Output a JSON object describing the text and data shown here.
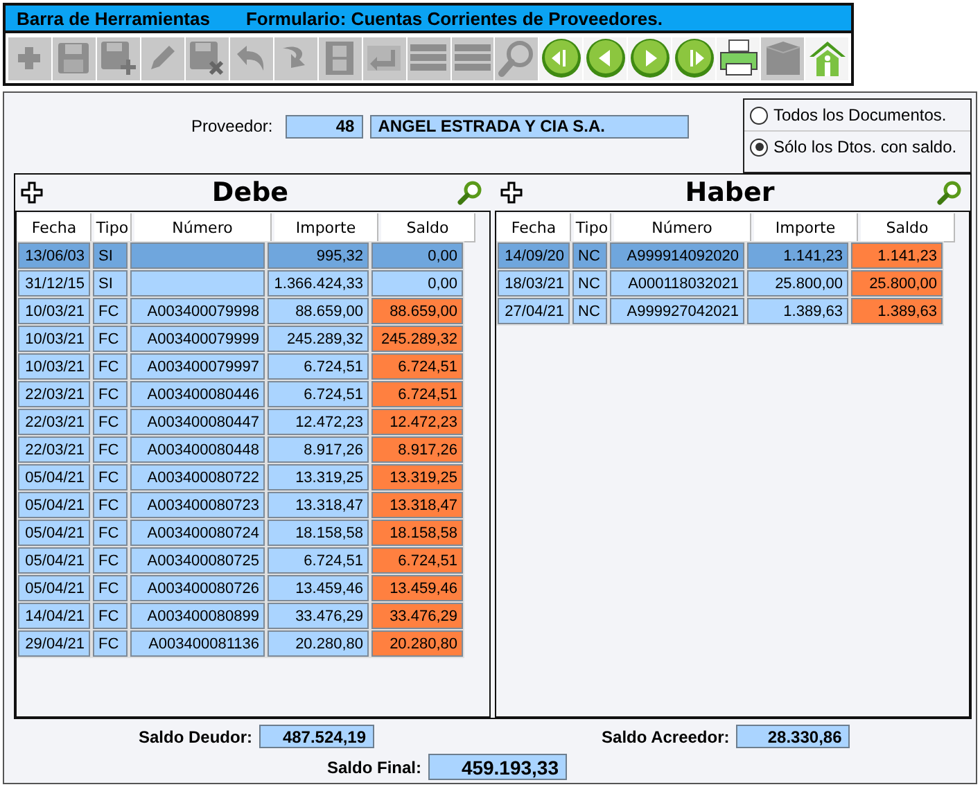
{
  "toolbar": {
    "title": "Barra de Herramientas",
    "form_title": "Formulario: Cuentas Corrientes de Proveedores.",
    "buttons": [
      {
        "kind": "add",
        "disabled": true
      },
      {
        "kind": "save",
        "disabled": true
      },
      {
        "kind": "save-add",
        "disabled": true
      },
      {
        "kind": "edit",
        "disabled": true
      },
      {
        "kind": "save-delete",
        "disabled": true
      },
      {
        "kind": "undo",
        "disabled": true
      },
      {
        "kind": "redo",
        "disabled": true
      },
      {
        "kind": "film",
        "disabled": true
      },
      {
        "kind": "enter",
        "disabled": true
      },
      {
        "kind": "list",
        "disabled": true
      },
      {
        "kind": "list",
        "disabled": true
      },
      {
        "kind": "search",
        "disabled": true
      },
      {
        "kind": "first",
        "disabled": false
      },
      {
        "kind": "prev",
        "disabled": false
      },
      {
        "kind": "next",
        "disabled": false
      },
      {
        "kind": "last",
        "disabled": false
      },
      {
        "kind": "printer",
        "disabled": false
      },
      {
        "kind": "box",
        "disabled": true
      },
      {
        "kind": "home",
        "disabled": false
      }
    ]
  },
  "proveedor": {
    "label": "Proveedor:",
    "code": "48",
    "name": "ANGEL ESTRADA Y CIA S.A."
  },
  "filter": [
    {
      "label": "Todos los Documentos.",
      "selected": false
    },
    {
      "label": "Sólo los Dtos. con saldo.",
      "selected": true
    }
  ],
  "debe": {
    "title": "Debe",
    "columns": [
      "Fecha",
      "Tipo",
      "Número",
      "Importe",
      "Saldo"
    ],
    "rows": [
      {
        "fecha": "13/06/03",
        "tipo": "SI",
        "numero": "",
        "importe": "995,32",
        "saldo": "0,00",
        "selected": true,
        "pending": false
      },
      {
        "fecha": "31/12/15",
        "tipo": "SI",
        "numero": "",
        "importe": "1.366.424,33",
        "saldo": "0,00",
        "selected": false,
        "pending": false
      },
      {
        "fecha": "10/03/21",
        "tipo": "FC",
        "numero": "A003400079998",
        "importe": "88.659,00",
        "saldo": "88.659,00",
        "selected": false,
        "pending": true
      },
      {
        "fecha": "10/03/21",
        "tipo": "FC",
        "numero": "A003400079999",
        "importe": "245.289,32",
        "saldo": "245.289,32",
        "selected": false,
        "pending": true
      },
      {
        "fecha": "10/03/21",
        "tipo": "FC",
        "numero": "A003400079997",
        "importe": "6.724,51",
        "saldo": "6.724,51",
        "selected": false,
        "pending": true
      },
      {
        "fecha": "22/03/21",
        "tipo": "FC",
        "numero": "A003400080446",
        "importe": "6.724,51",
        "saldo": "6.724,51",
        "selected": false,
        "pending": true
      },
      {
        "fecha": "22/03/21",
        "tipo": "FC",
        "numero": "A003400080447",
        "importe": "12.472,23",
        "saldo": "12.472,23",
        "selected": false,
        "pending": true
      },
      {
        "fecha": "22/03/21",
        "tipo": "FC",
        "numero": "A003400080448",
        "importe": "8.917,26",
        "saldo": "8.917,26",
        "selected": false,
        "pending": true
      },
      {
        "fecha": "05/04/21",
        "tipo": "FC",
        "numero": "A003400080722",
        "importe": "13.319,25",
        "saldo": "13.319,25",
        "selected": false,
        "pending": true
      },
      {
        "fecha": "05/04/21",
        "tipo": "FC",
        "numero": "A003400080723",
        "importe": "13.318,47",
        "saldo": "13.318,47",
        "selected": false,
        "pending": true
      },
      {
        "fecha": "05/04/21",
        "tipo": "FC",
        "numero": "A003400080724",
        "importe": "18.158,58",
        "saldo": "18.158,58",
        "selected": false,
        "pending": true
      },
      {
        "fecha": "05/04/21",
        "tipo": "FC",
        "numero": "A003400080725",
        "importe": "6.724,51",
        "saldo": "6.724,51",
        "selected": false,
        "pending": true
      },
      {
        "fecha": "05/04/21",
        "tipo": "FC",
        "numero": "A003400080726",
        "importe": "13.459,46",
        "saldo": "13.459,46",
        "selected": false,
        "pending": true
      },
      {
        "fecha": "14/04/21",
        "tipo": "FC",
        "numero": "A003400080899",
        "importe": "33.476,29",
        "saldo": "33.476,29",
        "selected": false,
        "pending": true
      },
      {
        "fecha": "29/04/21",
        "tipo": "FC",
        "numero": "A003400081136",
        "importe": "20.280,80",
        "saldo": "20.280,80",
        "selected": false,
        "pending": true
      }
    ]
  },
  "haber": {
    "title": "Haber",
    "columns": [
      "Fecha",
      "Tipo",
      "Número",
      "Importe",
      "Saldo"
    ],
    "rows": [
      {
        "fecha": "14/09/20",
        "tipo": "NC",
        "numero": "A999914092020",
        "importe": "1.141,23",
        "saldo": "1.141,23",
        "selected": true,
        "pending": true
      },
      {
        "fecha": "18/03/21",
        "tipo": "NC",
        "numero": "A000118032021",
        "importe": "25.800,00",
        "saldo": "25.800,00",
        "selected": false,
        "pending": true
      },
      {
        "fecha": "27/04/21",
        "tipo": "NC",
        "numero": "A999927042021",
        "importe": "1.389,63",
        "saldo": "1.389,63",
        "selected": false,
        "pending": true
      }
    ]
  },
  "totals": {
    "deudor_label": "Saldo Deudor:",
    "deudor": "487.524,19",
    "acreedor_label": "Saldo Acreedor:",
    "acreedor": "28.330,86",
    "final_label": "Saldo Final:",
    "final": "459.193,33"
  }
}
